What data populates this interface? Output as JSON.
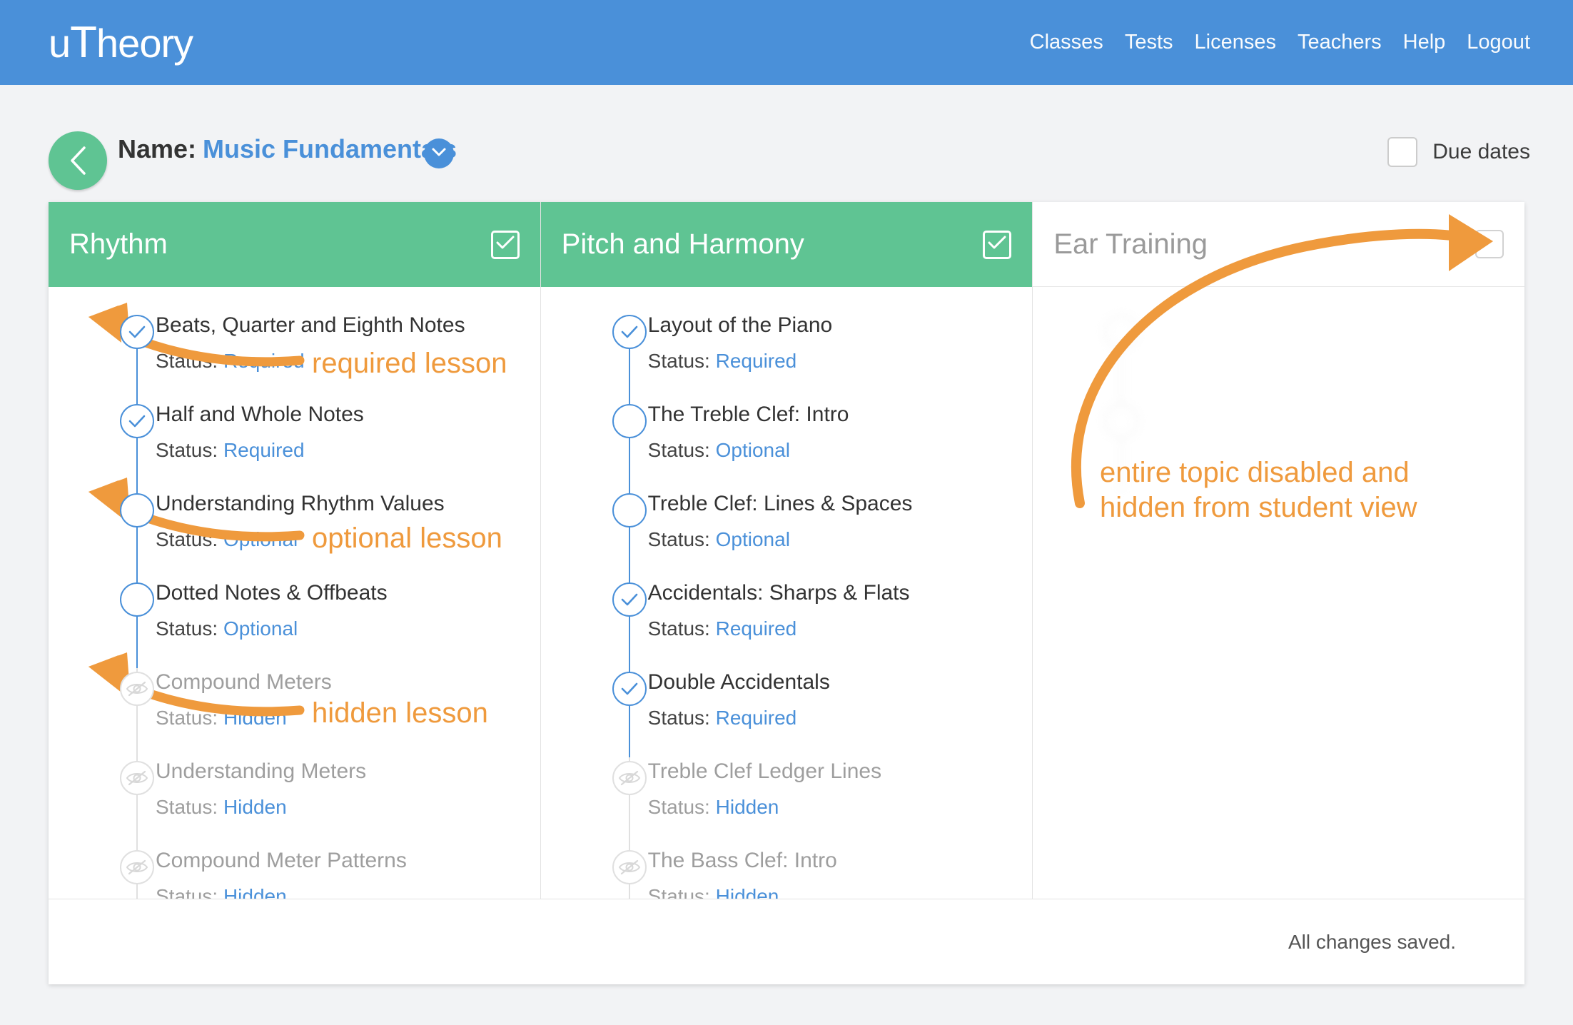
{
  "nav": {
    "logo": "uTheory",
    "logo_cap": "T",
    "links": [
      {
        "label": "Classes"
      },
      {
        "label": "Tests"
      },
      {
        "label": "Licenses"
      },
      {
        "label": "Teachers"
      },
      {
        "label": "Help"
      },
      {
        "label": "Logout"
      }
    ]
  },
  "header": {
    "back_icon": "chevron-left-icon",
    "name_label": "Name:",
    "name_value": "Music Fundamentals",
    "name_caret_icon": "chevron-down-icon",
    "due_dates_label": "Due dates",
    "due_dates_checked": false
  },
  "colors": {
    "nav_blue": "#4a90d9",
    "topic_green": "#5fc493",
    "link_blue": "#4a90d9",
    "annotation_orange": "#ef9a3d",
    "disabled_grey": "#9e9e9e"
  },
  "columns": [
    {
      "title": "Rhythm",
      "enabled": true,
      "checkbox_icon": "check-icon",
      "lessons": [
        {
          "title": "Beats, Quarter and Eighth Notes",
          "status_label": "Status:",
          "status": "Required",
          "state": "required",
          "icon": "check-circle-icon"
        },
        {
          "title": "Half and Whole Notes",
          "status_label": "Status:",
          "status": "Required",
          "state": "required",
          "icon": "check-circle-icon"
        },
        {
          "title": "Understanding Rhythm Values",
          "status_label": "Status:",
          "status": "Optional",
          "state": "optional",
          "icon": "empty-circle-icon"
        },
        {
          "title": "Dotted Notes & Offbeats",
          "status_label": "Status:",
          "status": "Optional",
          "state": "optional",
          "icon": "empty-circle-icon"
        },
        {
          "title": "Compound Meters",
          "status_label": "Status:",
          "status": "Hidden",
          "state": "hidden",
          "icon": "eye-slash-icon"
        },
        {
          "title": "Understanding Meters",
          "status_label": "Status:",
          "status": "Hidden",
          "state": "hidden",
          "icon": "eye-slash-icon"
        },
        {
          "title": "Compound Meter Patterns",
          "status_label": "Status:",
          "status": "Hidden",
          "state": "hidden",
          "icon": "eye-slash-icon"
        }
      ]
    },
    {
      "title": "Pitch and Harmony",
      "enabled": true,
      "checkbox_icon": "check-icon",
      "lessons": [
        {
          "title": "Layout of the Piano",
          "status_label": "Status:",
          "status": "Required",
          "state": "required",
          "icon": "check-circle-icon"
        },
        {
          "title": "The Treble Clef: Intro",
          "status_label": "Status:",
          "status": "Optional",
          "state": "optional",
          "icon": "empty-circle-icon"
        },
        {
          "title": "Treble Clef: Lines & Spaces",
          "status_label": "Status:",
          "status": "Optional",
          "state": "optional",
          "icon": "empty-circle-icon"
        },
        {
          "title": "Accidentals: Sharps & Flats",
          "status_label": "Status:",
          "status": "Required",
          "state": "required",
          "icon": "check-circle-icon"
        },
        {
          "title": "Double Accidentals",
          "status_label": "Status:",
          "status": "Required",
          "state": "required",
          "icon": "check-circle-icon"
        },
        {
          "title": "Treble Clef Ledger Lines",
          "status_label": "Status:",
          "status": "Hidden",
          "state": "hidden",
          "icon": "eye-slash-icon"
        },
        {
          "title": "The Bass Clef: Intro",
          "status_label": "Status:",
          "status": "Hidden",
          "state": "hidden",
          "icon": "eye-slash-icon"
        }
      ]
    },
    {
      "title": "Ear Training",
      "enabled": false,
      "checkbox_icon": "empty-checkbox-icon",
      "lessons": [
        {
          "title": "",
          "status_label": "",
          "status": "",
          "state": "ghost",
          "icon": "eye-slash-icon"
        },
        {
          "title": "",
          "status_label": "",
          "status": "",
          "state": "ghost",
          "icon": "eye-slash-icon"
        }
      ]
    }
  ],
  "footer": {
    "saved_text": "All changes saved."
  },
  "annotations": [
    {
      "text": "required lesson"
    },
    {
      "text": "optional lesson"
    },
    {
      "text": "hidden lesson"
    },
    {
      "text_line1": "entire topic disabled and",
      "text_line2": "hidden from student view"
    }
  ]
}
